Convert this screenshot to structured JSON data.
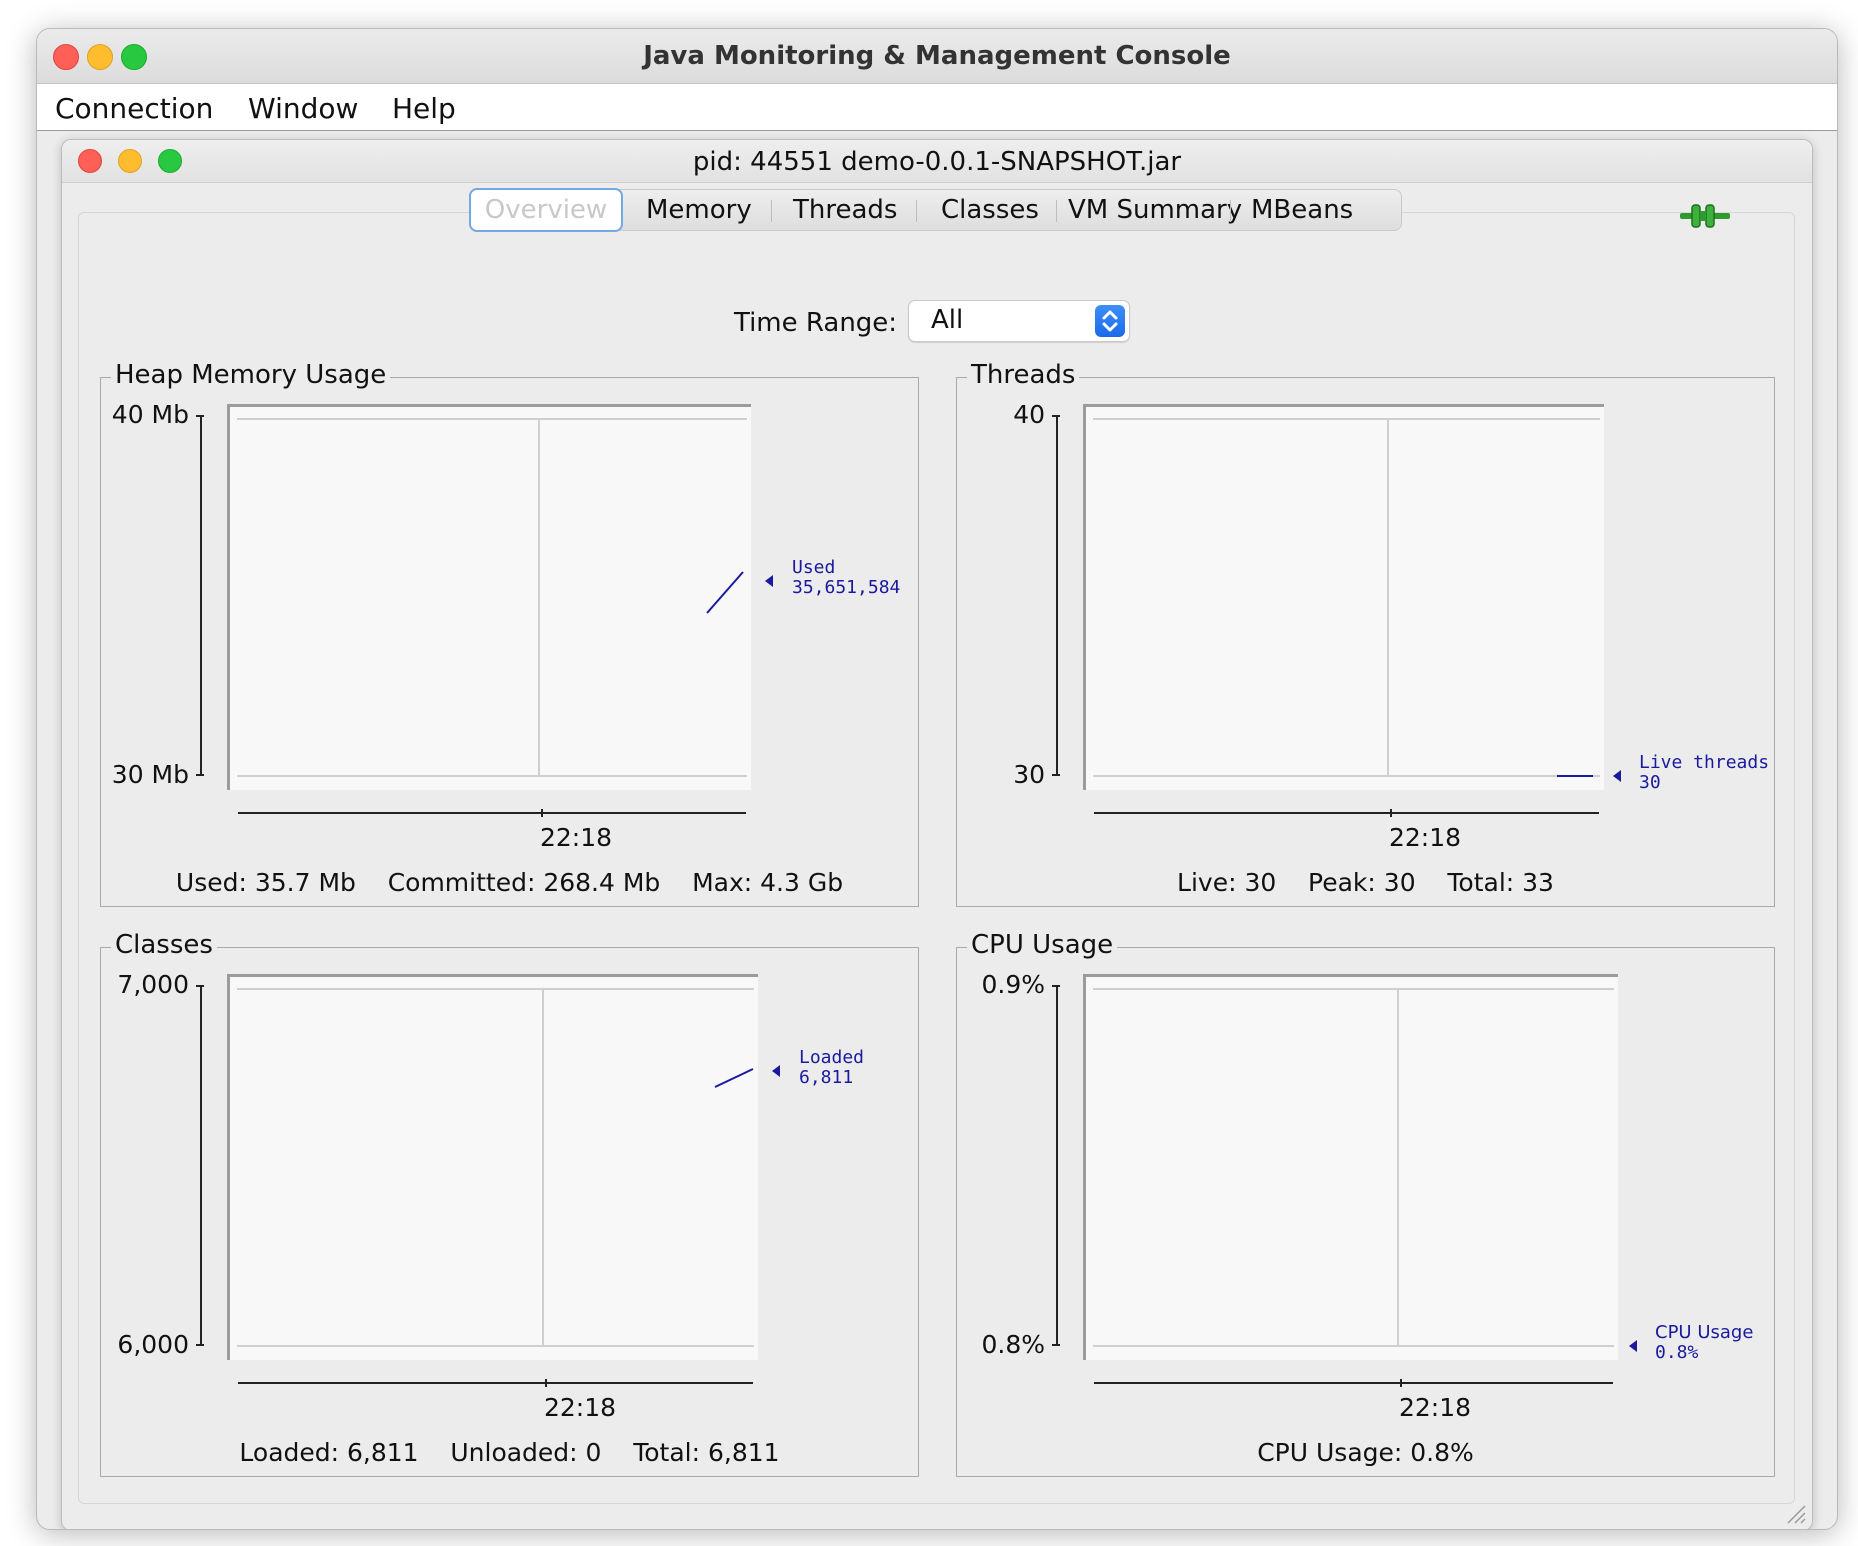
{
  "app": {
    "title": "Java Monitoring & Management Console",
    "menu": [
      "Connection",
      "Window",
      "Help"
    ]
  },
  "window": {
    "title": "pid: 44551 demo-0.0.1-SNAPSHOT.jar"
  },
  "tabs": [
    "Overview",
    "Memory",
    "Threads",
    "Classes",
    "VM Summary",
    "MBeans"
  ],
  "active_tab": "Overview",
  "time_range": {
    "label": "Time Range:",
    "value": "All"
  },
  "colors": {
    "series": "#1a1a9e",
    "accent": "#1a6ae8"
  },
  "icons": {
    "connection": "connection-plug-icon",
    "stepper": "select-stepper-icon"
  },
  "panels": {
    "heap": {
      "title": "Heap Memory Usage",
      "y_top": "40 Mb",
      "y_bottom": "30 Mb",
      "x_tick": "22:18",
      "series_name": "Used",
      "series_value": "35,651,584",
      "stats": "Used: 35.7 Mb    Committed: 268.4 Mb    Max: 4.3 Gb"
    },
    "threads": {
      "title": "Threads",
      "y_top": "40",
      "y_bottom": "30",
      "x_tick": "22:18",
      "series_name": "Live threads",
      "series_value": "30",
      "stats": "Live: 30    Peak: 30    Total: 33"
    },
    "classes": {
      "title": "Classes",
      "y_top": "7,000",
      "y_bottom": "6,000",
      "x_tick": "22:18",
      "series_name": "Loaded",
      "series_value": "6,811",
      "stats": "Loaded: 6,811    Unloaded: 0    Total: 6,811"
    },
    "cpu": {
      "title": "CPU Usage",
      "y_top": "0.9%",
      "y_bottom": "0.8%",
      "x_tick": "22:18",
      "series_name": "CPU Usage",
      "series_value": "0.8%",
      "stats": "CPU Usage: 0.8%"
    }
  },
  "chart_data": [
    {
      "type": "line",
      "title": "Heap Memory Usage",
      "ylim": [
        30,
        40
      ],
      "x_ticks": [
        "22:18"
      ],
      "series": [
        {
          "name": "Used",
          "values": [
            33.9,
            35.65
          ]
        }
      ]
    },
    {
      "type": "line",
      "title": "Threads",
      "ylim": [
        30,
        40
      ],
      "x_ticks": [
        "22:18"
      ],
      "series": [
        {
          "name": "Live threads",
          "values": [
            30,
            30
          ]
        }
      ]
    },
    {
      "type": "line",
      "title": "Classes",
      "ylim": [
        6000,
        7000
      ],
      "x_ticks": [
        "22:18"
      ],
      "series": [
        {
          "name": "Loaded",
          "values": [
            6770,
            6811
          ]
        }
      ]
    },
    {
      "type": "line",
      "title": "CPU Usage",
      "ylim": [
        0.8,
        0.9
      ],
      "x_ticks": [
        "22:18"
      ],
      "series": [
        {
          "name": "CPU Usage",
          "values": [
            0.8,
            0.8
          ]
        }
      ]
    }
  ]
}
